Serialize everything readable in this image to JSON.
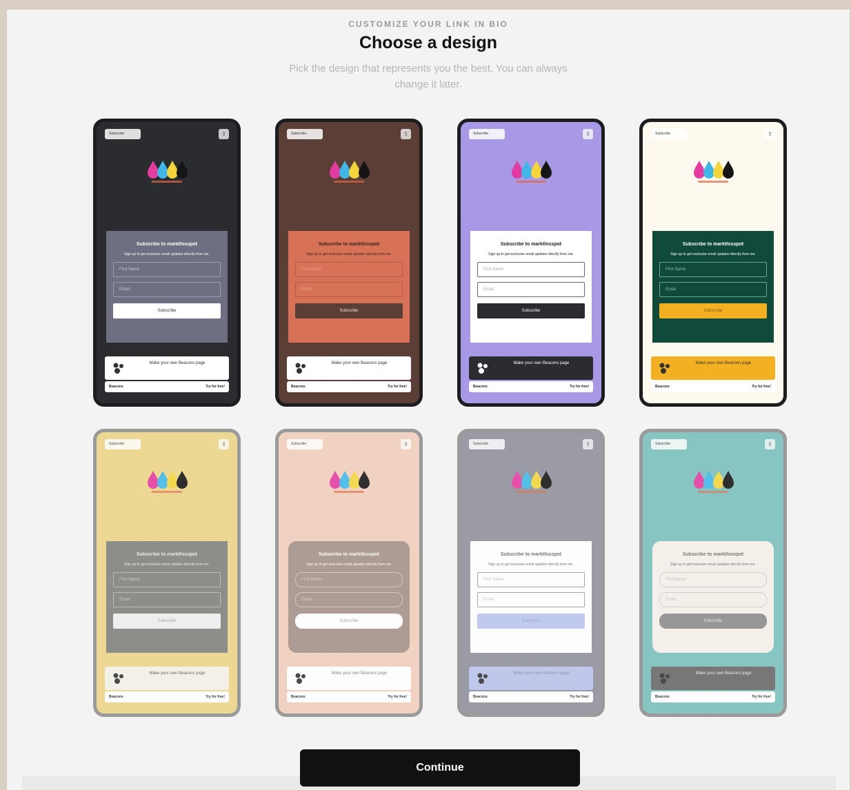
{
  "header": {
    "eyebrow": "CUSTOMIZE YOUR LINK IN BIO",
    "title": "Choose a design",
    "subtitle": "Pick the design that represents you the best. You can always change it later."
  },
  "preview_text": {
    "subscribe_pill": "Subscribe",
    "share_glyph": "⇪",
    "card_title": "Subscribe to markthisspot",
    "card_desc": "Sign up to get exclusive email updates directly from me.",
    "first_name_placeholder": "First Name",
    "email_placeholder": "Email",
    "button_label": "Subscribe",
    "promo_text": "Make your own Beacons page",
    "footer_brand": "Beacons",
    "footer_try": "Try for free!"
  },
  "designs": [
    {
      "id": "dark",
      "bg": "#2b2c30",
      "card_bg": "#6e6f80",
      "card_text": "#ffffff",
      "field_border": "#9e9fae",
      "field_text": "#c8c8d2",
      "btn_bg": "#ffffff",
      "btn_text": "#333333",
      "promo_bg": "#ffffff",
      "promo_text": "#333333"
    },
    {
      "id": "brown",
      "bg": "#5b3f36",
      "card_bg": "#d77257",
      "card_text": "#3a2520",
      "field_border": "#b55a44",
      "field_text": "#e9a08c",
      "btn_bg": "#5b3f36",
      "btn_text": "#f2e2dc",
      "promo_bg": "#ffffff",
      "promo_text": "#333333"
    },
    {
      "id": "lavender",
      "bg": "#a998e6",
      "card_bg": "#ffffff",
      "card_text": "#222222",
      "field_border": "#666666",
      "field_text": "#aaaaaa",
      "btn_bg": "#2b2c30",
      "btn_text": "#ffffff",
      "promo_bg": "#2b2c30",
      "promo_text": "#ffffff"
    },
    {
      "id": "forest",
      "bg": "#fdf9ee",
      "card_bg": "#0f4a3a",
      "card_text": "#ffffff",
      "field_border": "#6ea595",
      "field_text": "#8fbfb0",
      "btn_bg": "#f4b023",
      "btn_text": "#7a5a10",
      "promo_bg": "#f4b023",
      "promo_text": "#333333"
    },
    {
      "id": "mustard",
      "bg": "#ecd585",
      "card_bg": "#7f7f7c",
      "card_text": "#ececec",
      "field_border": "#b5b5b0",
      "field_text": "#c8c8c4",
      "btn_bg": "#eeeeee",
      "btn_text": "#999999",
      "promo_bg": "#f3f0e6",
      "promo_text": "#555555"
    },
    {
      "id": "peach",
      "bg": "#f1cdb8",
      "card_bg": "#a49188",
      "card_text": "#ffffff",
      "field_border": "#cfc1b9",
      "field_text": "#d8cbc3",
      "btn_bg": "#ffffff",
      "btn_text": "#999999",
      "promo_bg": "#ffffff",
      "promo_text": "#777777"
    },
    {
      "id": "slate",
      "bg": "#8e8f9b",
      "card_bg": "#ffffff",
      "card_text": "#666666",
      "field_border": "#9a9aa5",
      "field_text": "#bbbbbb",
      "btn_bg": "#b9c5ee",
      "btn_text": "#8f9ccc",
      "promo_bg": "#b8c1ea",
      "promo_text": "#8088aa"
    },
    {
      "id": "teal",
      "bg": "#79bfbd",
      "card_bg": "#f6efe9",
      "card_text": "#666666",
      "field_border": "#cccccc",
      "field_text": "#bbbbbb",
      "btn_bg": "#8b8b8b",
      "btn_text": "#e5e5e5",
      "promo_bg": "#666666",
      "promo_text": "#eeeeee"
    }
  ],
  "continue_label": "Continue"
}
